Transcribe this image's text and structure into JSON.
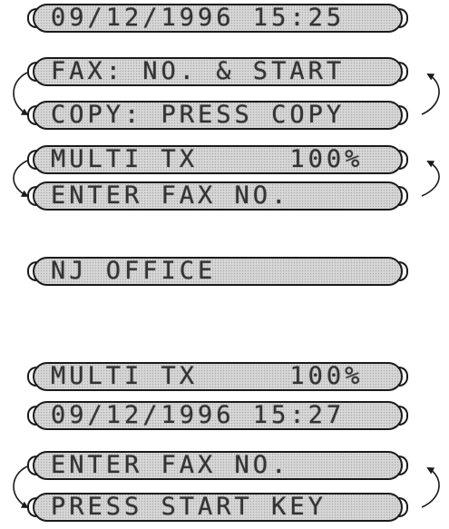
{
  "displays": [
    {
      "text": "09/12/1996 15:25"
    },
    {
      "text": "FAX: NO. & START"
    },
    {
      "text": "COPY: PRESS COPY"
    },
    {
      "text": "MULTI TX     100%"
    },
    {
      "text": "ENTER FAX NO."
    },
    {
      "text": "NJ OFFICE"
    },
    {
      "text": "MULTI TX     100%"
    },
    {
      "text": "09/12/1996 15:27"
    },
    {
      "text": "ENTER FAX NO."
    },
    {
      "text": "PRESS START KEY"
    }
  ],
  "colors": {
    "frame": "#1a1a1a",
    "screen": "#d8d8d8",
    "text": "#333333"
  },
  "icons": [
    "cycle-arrow-left-icon",
    "cycle-arrow-right-icon"
  ]
}
